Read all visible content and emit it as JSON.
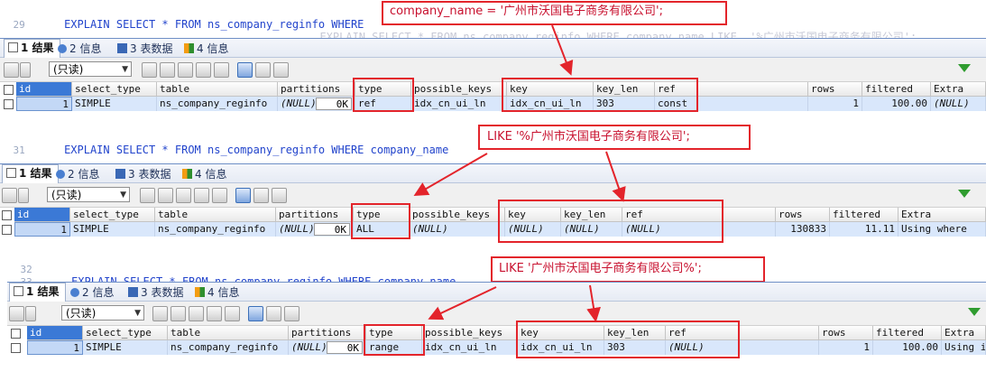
{
  "code": {
    "line29": {
      "num": "29",
      "prefix": "EXPLAIN SELECT * FROM ns_company_reginfo WHERE ",
      "cond": "company_name = '广州市沃国电子商务有限公司';"
    },
    "ghost1": {
      "text": "  EXPLAIN SELECT * FROM ns_company_reginfo WHERE company_name LIKE  '%广州市沃国电子商务有限公司';"
    },
    "line31": {
      "num": "31",
      "prefix": "EXPLAIN SELECT * FROM ns_company_reginfo WHERE company_name ",
      "cond": "LIKE '%广州市沃国电子商务有限公司';"
    },
    "line32": {
      "num": "32"
    },
    "line33": {
      "num": "33",
      "prefix": "EXPLAIN SELECT * FROM ns_company_reginfo WHERE company_name ",
      "cond": "LIKE '广州市沃国电子商务有限公司%';"
    }
  },
  "tabs": {
    "result": "1 结果",
    "info": "2 信息",
    "tabledata": "3 表数据",
    "info4": "4 信息"
  },
  "toolbar": {
    "readonly": "(只读)"
  },
  "columns": [
    "id",
    "select_type",
    "table",
    "partitions",
    "type",
    "possible_keys",
    "key",
    "key_len",
    "ref",
    "rows",
    "filtered",
    "Extra"
  ],
  "results": [
    {
      "id": "1",
      "select_type": "SIMPLE",
      "table": "ns_company_reginfo",
      "partitions": "(NULL)",
      "ok": "0K",
      "type": "ref",
      "possible_keys": "idx_cn_ui_ln",
      "key": "idx_cn_ui_ln",
      "key_len": "303",
      "ref": "const",
      "rows": "1",
      "filtered": "100.00",
      "Extra": "(NULL)"
    },
    {
      "id": "1",
      "select_type": "SIMPLE",
      "table": "ns_company_reginfo",
      "partitions": "(NULL)",
      "ok": "0K",
      "type": "ALL",
      "possible_keys": "(NULL)",
      "key": "(NULL)",
      "key_len": "(NULL)",
      "ref": "(NULL)",
      "rows": "130833",
      "filtered": "11.11",
      "Extra": "Using where"
    },
    {
      "id": "1",
      "select_type": "SIMPLE",
      "table": "ns_company_reginfo",
      "partitions": "(NULL)",
      "ok": "0K",
      "type": "range",
      "possible_keys": "idx_cn_ui_ln",
      "key": "idx_cn_ui_ln",
      "key_len": "303",
      "ref": "(NULL)",
      "rows": "1",
      "filtered": "100.00",
      "Extra": "Using in"
    }
  ],
  "colors": {
    "annotation": "#e3242b",
    "keyword": "#2244cc",
    "string": "#c8102e",
    "selection": "#d9e7fb"
  }
}
